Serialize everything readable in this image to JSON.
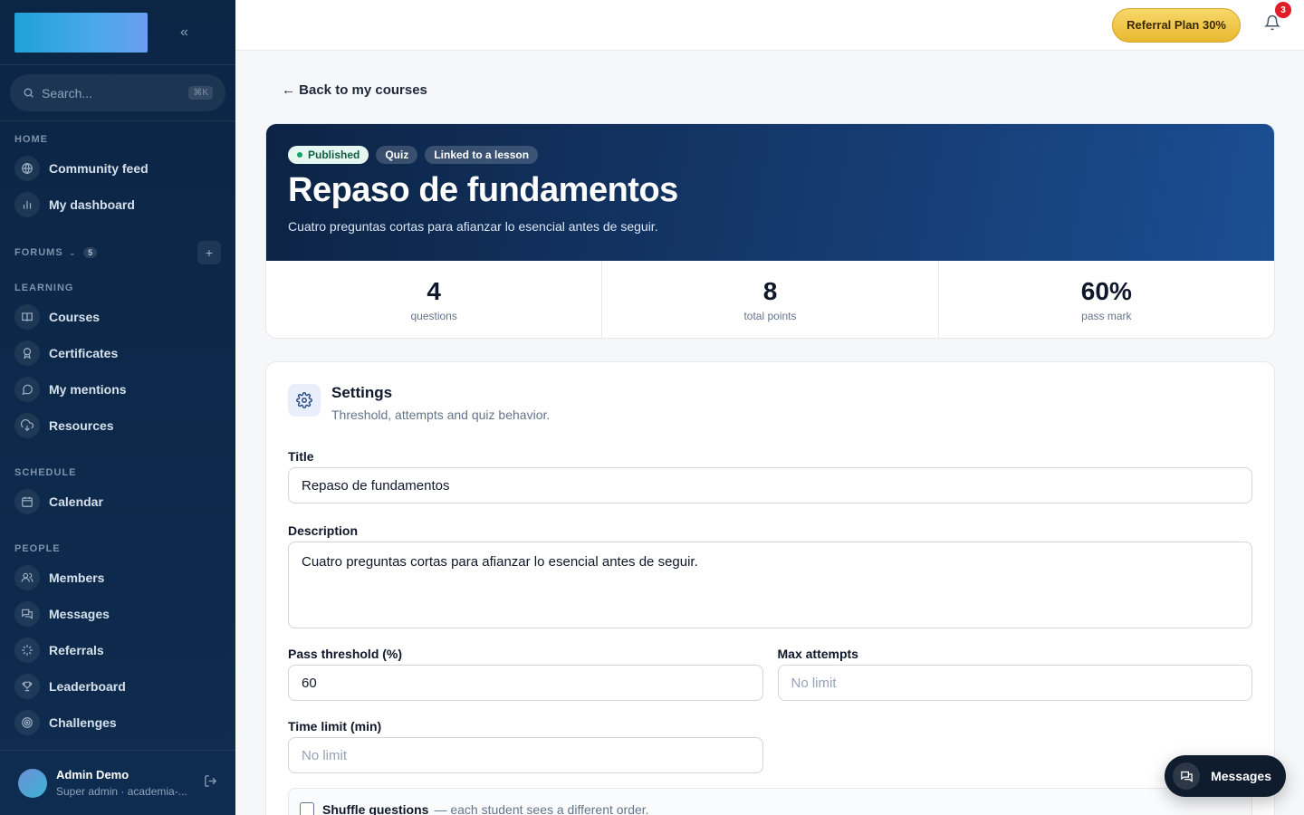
{
  "sidebar": {
    "search_placeholder": "Search...",
    "search_shortcut": "⌘K",
    "sections": {
      "home": "HOME",
      "forums": "FORUMS",
      "forums_count": "5",
      "learning": "LEARNING",
      "schedule": "SCHEDULE",
      "people": "PEOPLE"
    },
    "home_items": [
      {
        "label": "Community feed",
        "icon": "globe-icon"
      },
      {
        "label": "My dashboard",
        "icon": "bar-chart-icon"
      }
    ],
    "learning_items": [
      {
        "label": "Courses",
        "icon": "book-icon"
      },
      {
        "label": "Certificates",
        "icon": "award-icon"
      },
      {
        "label": "My mentions",
        "icon": "chat-icon"
      },
      {
        "label": "Resources",
        "icon": "cloud-download-icon"
      }
    ],
    "schedule_items": [
      {
        "label": "Calendar",
        "icon": "calendar-icon"
      }
    ],
    "people_items": [
      {
        "label": "Members",
        "icon": "users-icon"
      },
      {
        "label": "Messages",
        "icon": "messages-icon"
      },
      {
        "label": "Referrals",
        "icon": "sparkle-icon"
      },
      {
        "label": "Leaderboard",
        "icon": "trophy-icon"
      },
      {
        "label": "Challenges",
        "icon": "target-icon"
      }
    ],
    "user": {
      "name": "Admin Demo",
      "role": "Super admin · academia-..."
    }
  },
  "topbar": {
    "referral_label": "Referral Plan 30%",
    "notification_count": "3"
  },
  "main": {
    "back_label": "← Back to my courses",
    "tags": {
      "published": "Published",
      "quiz": "Quiz",
      "linked": "Linked to a lesson"
    },
    "title": "Repaso de fundamentos",
    "subtitle": "Cuatro preguntas cortas para afianzar lo esencial antes de seguir.",
    "stats": [
      {
        "value": "4",
        "label": "questions"
      },
      {
        "value": "8",
        "label": "total points"
      },
      {
        "value": "60%",
        "label": "pass mark"
      }
    ],
    "settings": {
      "title": "Settings",
      "subtitle": "Threshold, attempts and quiz behavior.",
      "title_label": "Title",
      "title_value": "Repaso de fundamentos",
      "description_label": "Description",
      "description_value": "Cuatro preguntas cortas para afianzar lo esencial antes de seguir.",
      "pass_label": "Pass threshold (%)",
      "pass_value": "60",
      "max_attempts_label": "Max attempts",
      "max_attempts_placeholder": "No limit",
      "time_limit_label": "Time limit (min)",
      "time_limit_placeholder": "No limit",
      "shuffle_label": "Shuffle questions",
      "shuffle_hint": "— each student sees a different order.",
      "shuffle_checked": false
    }
  },
  "fab": {
    "messages_label": "Messages"
  },
  "colors": {
    "sidebar_bg": "#0b2545",
    "hero_start": "#0c2344",
    "hero_end": "#1b4e93",
    "referral_gold": "#f0c94a",
    "published_green": "#14a36b",
    "notification_red": "#e11d2a"
  }
}
